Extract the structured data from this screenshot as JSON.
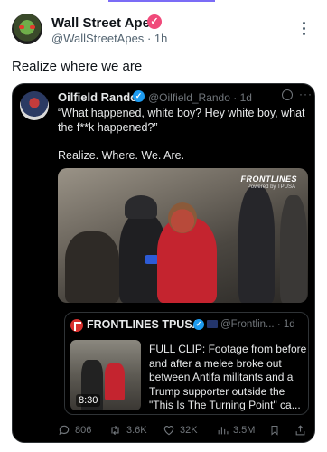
{
  "post": {
    "author_name": "Wall Street Apes",
    "author_handle": "@WallStreetApes",
    "time": "1h",
    "text": "Realize where we are"
  },
  "quote": {
    "author_name": "Oilfield Rando",
    "author_handle": "@Oilfield_Rando",
    "time": "1d",
    "line1": "“What happened, white boy? Hey white boy, what the f**k happened?”",
    "line2": "Realize. Where. We. Are.",
    "video_watermark": "FRONTLINES",
    "video_watermark_sub": "Powered by TPUSA"
  },
  "nested": {
    "author_name": "FRONTLINES TPUSA",
    "author_handle": "@Frontlin...",
    "time": "1d",
    "duration": "8:30",
    "text": "FULL CLIP: Footage from before and after a melee broke out between Antifa militants and a Trump supporter outside the \"This Is The Turning Point\" ca..."
  },
  "actions": {
    "replies": "806",
    "reposts": "3.6K",
    "likes": "32K",
    "views": "3.5M"
  },
  "icons": [
    "verified-badge-icon",
    "more-vertical-icon",
    "grok-icon",
    "more-horizontal-icon",
    "reply-icon",
    "repost-icon",
    "like-icon",
    "views-icon",
    "bookmark-icon",
    "share-icon"
  ],
  "colors": {
    "accent_verified_org": "#f04a7a",
    "verified_blue": "#1d9bf0",
    "card_background": "#000000",
    "muted_text": "#71767b"
  }
}
